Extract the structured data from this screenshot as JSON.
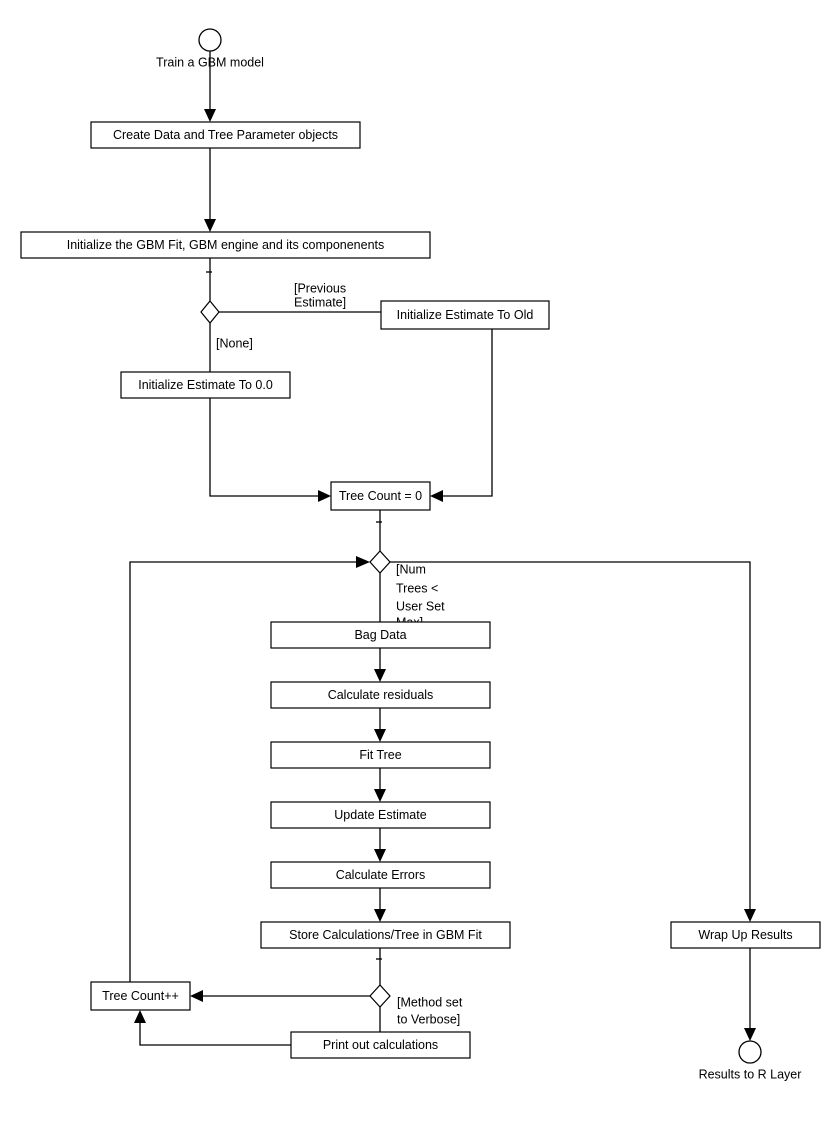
{
  "diagram": {
    "title": "Train a GBM model",
    "type": "uml-activity-diagram",
    "colors": {
      "background": "#ffffff",
      "stroke": "#000000",
      "fill": "#ffffff",
      "text": "#000000"
    },
    "start_node": {
      "label": "Train a GBM model",
      "shape": "circle"
    },
    "end_node": {
      "label": "Results to R Layer",
      "shape": "circle"
    },
    "nodes": {
      "create_data": "Create Data and Tree Parameter objects",
      "initialize_gbm": "Initialize the GBM Fit, GBM engine and its componenents",
      "init_estimate_old": "Initialize Estimate To Old",
      "init_estimate_zero": "Initialize Estimate To 0.0",
      "tree_count_zero": "Tree Count = 0",
      "bag_data": "Bag Data",
      "calculate_residuals": "Calculate residuals",
      "fit_tree": "Fit Tree",
      "update_estimate": "Update Estimate",
      "calculate_errors": "Calculate Errors",
      "store_calculations": "Store Calculations/Tree in GBM Fit",
      "tree_count_increment": "Tree Count++",
      "print_calculations": "Print out calculations",
      "wrap_up_results": "Wrap Up Results"
    },
    "edge_labels": {
      "previous_estimate_line1": "[Previous",
      "previous_estimate_line2": "Estimate]",
      "none": "[None]",
      "num_trees_line1": "[Num",
      "num_trees_line2": "Trees <",
      "num_trees_line3": "User Set",
      "num_trees_line4": "Max]",
      "verbose_line1": "[Method set",
      "verbose_line2": "to Verbose]"
    },
    "decisions": {
      "estimate_choice": "estimate-initialization-decision",
      "loop_condition": "tree-loop-decision",
      "verbose_choice": "verbose-output-decision"
    }
  }
}
